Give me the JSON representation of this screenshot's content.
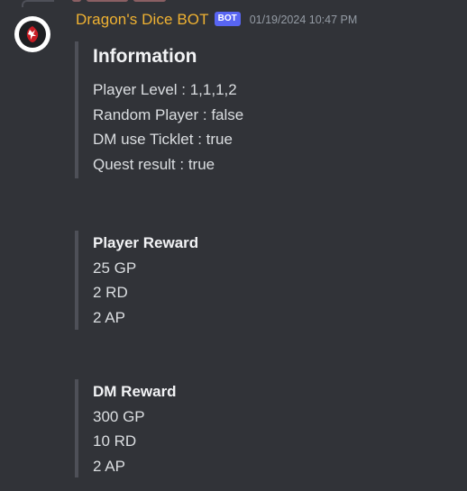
{
  "message": {
    "author": "Dragon's Dice BOT",
    "bot_tag": "BOT",
    "timestamp": "01/19/2024 10:47 PM",
    "avatar_icon": "dragon-icon"
  },
  "colors": {
    "background": "#313338",
    "username": "#f0b232",
    "bot_tag": "#5865f2",
    "embed_border": "#4e5058"
  },
  "embeds": {
    "information": {
      "title": "Information",
      "lines": [
        "Player Level : 1,1,1,2",
        "Random Player : false",
        "DM use Ticklet : true",
        "Quest result : true"
      ]
    },
    "player_reward": {
      "title": "Player Reward",
      "lines": [
        "25 GP",
        "2 RD",
        "2 AP"
      ]
    },
    "dm_reward": {
      "title": "DM Reward",
      "lines": [
        "300 GP",
        "10 RD",
        "2 AP"
      ]
    }
  }
}
